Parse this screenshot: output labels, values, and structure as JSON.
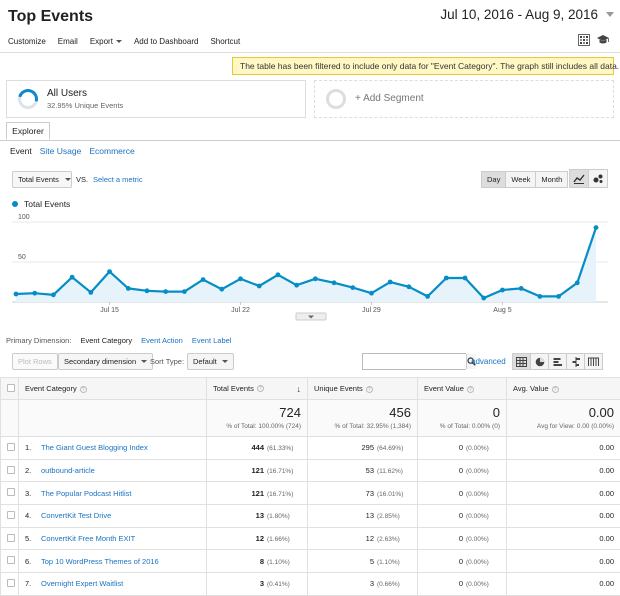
{
  "page_title": "Top Events",
  "date_range": "Jul 10, 2016 - Aug 9, 2016",
  "toolbar": {
    "customize": "Customize",
    "email": "Email",
    "export": "Export",
    "add_dashboard": "Add to Dashboard",
    "shortcut": "Shortcut"
  },
  "notice": "The table has been filtered to include only data for \"Event Category\". The graph still includes all data.",
  "segments": {
    "all_users": "All Users",
    "all_users_sub": "32.95% Unique Events",
    "add_segment": "+ Add Segment"
  },
  "explorer_tab": "Explorer",
  "subtabs": [
    "Event",
    "Site Usage",
    "Ecommerce"
  ],
  "metric_select": "Total Events",
  "vs": "VS.",
  "select_metric": "Select a metric",
  "period_buttons": [
    "Day",
    "Week",
    "Month"
  ],
  "legend_label": "Total Events",
  "chart_data": {
    "type": "area",
    "series": [
      {
        "name": "Total Events",
        "values": [
          10,
          11,
          9,
          31,
          12,
          38,
          17,
          14,
          13,
          13,
          28,
          16,
          29,
          20,
          34,
          21,
          29,
          24,
          18,
          11,
          25,
          19,
          7,
          30,
          30,
          5,
          15,
          17,
          7,
          7,
          24,
          93
        ]
      }
    ],
    "y_ticks": [
      "100",
      "50"
    ],
    "x_ticks": [
      "Jul 15",
      "Jul 22",
      "Jul 29",
      "Aug 5"
    ],
    "ylim": [
      0,
      100
    ],
    "color": "#058dc7",
    "fill": "#e6f3fa",
    "grid": true
  },
  "primary_dimension": {
    "label": "Primary Dimension:",
    "current": "Event Category",
    "options": [
      "Event Action",
      "Event Label"
    ]
  },
  "table_controls": {
    "plot_rows": "Plot Rows",
    "secondary_dimension": "Secondary dimension",
    "sort_type_label": "Sort Type:",
    "sort_type_value": "Default",
    "search_placeholder": "",
    "advanced": "advanced"
  },
  "table": {
    "headers": [
      "Event Category",
      "Total Events",
      "Unique Events",
      "Event Value",
      "Avg. Value"
    ],
    "totals": {
      "total_events": "724",
      "total_events_sub": "% of Total: 100.00% (724)",
      "unique_events": "456",
      "unique_events_sub": "% of Total: 32.95% (1,384)",
      "event_value": "0",
      "event_value_sub": "% of Total: 0.00% (0)",
      "avg_value": "0.00",
      "avg_value_sub": "Avg for View: 0.00 (0.00%)"
    },
    "rows": [
      {
        "idx": "1.",
        "name": "The Giant Guest Blogging Index",
        "total": "444",
        "total_pct": "(61.33%)",
        "unique": "295",
        "unique_pct": "(64.69%)",
        "value": "0",
        "value_pct": "(0.00%)",
        "avg": "0.00"
      },
      {
        "idx": "2.",
        "name": "outbound-article",
        "total": "121",
        "total_pct": "(16.71%)",
        "unique": "53",
        "unique_pct": "(11.62%)",
        "value": "0",
        "value_pct": "(0.00%)",
        "avg": "0.00"
      },
      {
        "idx": "3.",
        "name": "The Popular Podcast Hitlist",
        "total": "121",
        "total_pct": "(16.71%)",
        "unique": "73",
        "unique_pct": "(16.01%)",
        "value": "0",
        "value_pct": "(0.00%)",
        "avg": "0.00"
      },
      {
        "idx": "4.",
        "name": "ConvertKit Test Drive",
        "total": "13",
        "total_pct": "(1.80%)",
        "unique": "13",
        "unique_pct": "(2.85%)",
        "value": "0",
        "value_pct": "(0.00%)",
        "avg": "0.00"
      },
      {
        "idx": "5.",
        "name": "ConvertKit Free Month EXIT",
        "total": "12",
        "total_pct": "(1.66%)",
        "unique": "12",
        "unique_pct": "(2.63%)",
        "value": "0",
        "value_pct": "(0.00%)",
        "avg": "0.00"
      },
      {
        "idx": "6.",
        "name": "Top 10 WordPress Themes of 2016",
        "total": "8",
        "total_pct": "(1.10%)",
        "unique": "5",
        "unique_pct": "(1.10%)",
        "value": "0",
        "value_pct": "(0.00%)",
        "avg": "0.00"
      },
      {
        "idx": "7.",
        "name": "Overnight Expert Waitlist",
        "total": "3",
        "total_pct": "(0.41%)",
        "unique": "3",
        "unique_pct": "(0.66%)",
        "value": "0",
        "value_pct": "(0.00%)",
        "avg": "0.00"
      }
    ]
  }
}
